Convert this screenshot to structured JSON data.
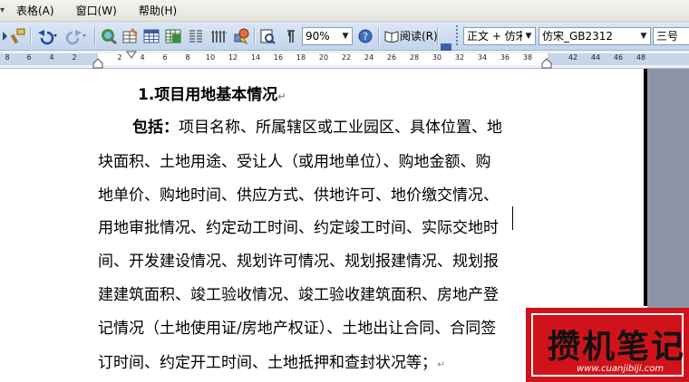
{
  "menu": {
    "arrow": "▾",
    "items": [
      "表格(A)",
      "窗口(W)",
      "帮助(H)"
    ]
  },
  "toolbar": {
    "zoom": "90%",
    "read_label": "阅读(R)",
    "style": "正文 + 仿宋",
    "font": "仿宋_GB2312",
    "size": "三号"
  },
  "ruler": {
    "numbers": [
      "8",
      "6",
      "4",
      "2",
      "2",
      "4",
      "6",
      "8",
      "10",
      "12",
      "14",
      "16",
      "18",
      "20",
      "22",
      "24",
      "26",
      "28",
      "30",
      "32",
      "34",
      "36",
      "38",
      "42",
      "44",
      "46",
      "48"
    ]
  },
  "document": {
    "heading": "1.项目用地基本情况",
    "lead": "包括：",
    "lines": [
      "项目名称、所属辖区或工业园区、具体位置、地",
      "块面积、土地用途、受让人（或用地单位）、购地金额、购",
      "地单价、购地时间、供应方式、供地许可、地价缴交情况、",
      "用地审批情况、约定动工时间、约定竣工时间、实际交地时",
      "间、开发建设情况、规划许可情况、规划报建情况、规划报",
      "建建筑面积、竣工验收情况、竣工验收建筑面积、房地产登",
      "记情况（土地使用证/房地产权证）、土地出让合同、合同签",
      "订时间、约定开工时间、土地抵押和查封状况等；"
    ],
    "para_mark": "↵"
  },
  "watermark": {
    "text": "攒机笔记",
    "url": "www.cuanjibiji.com"
  },
  "colors": {
    "toolbar": "#c3d4ec",
    "watermark_red": "#d0131b",
    "page_gray": "#8c95a8"
  }
}
